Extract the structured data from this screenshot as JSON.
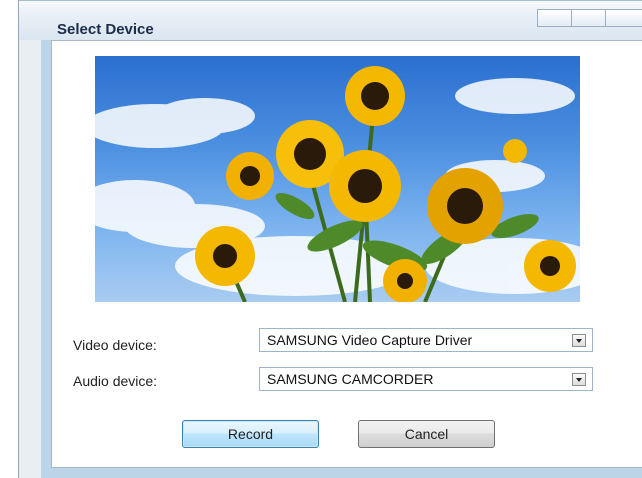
{
  "window": {
    "title": "Select Device"
  },
  "form": {
    "video_label": "Video device:",
    "video_value": "SAMSUNG Video Capture Driver",
    "audio_label": "Audio device:",
    "audio_value": "SAMSUNG CAMCORDER"
  },
  "buttons": {
    "record": "Record",
    "cancel": "Cancel"
  },
  "colors": {
    "titlebar": "#dbe6f1",
    "default_button_border": "#3c7fb1",
    "sky": "#4a8ee0",
    "sunflower": "#f5b800"
  }
}
